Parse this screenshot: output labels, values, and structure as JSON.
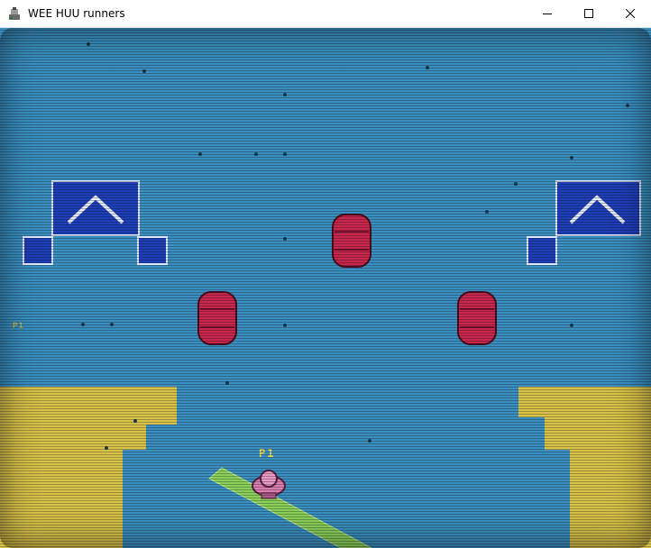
{
  "window": {
    "title": "WEE HUU runners",
    "icon": "game-app-icon",
    "controls": [
      "minimize-icon",
      "maximize-icon",
      "close-icon"
    ]
  },
  "hud": {
    "player_label": "P1",
    "side_label": "P1"
  },
  "colors": {
    "field": "#3a8fc0",
    "scanline_dark": "#1e5f86",
    "sand": "#d8c24a",
    "pad_blue": "#1f3fb8",
    "bumper_red": "#c8284e",
    "player_pink": "#d97fb0",
    "track_green": "#8ad05a"
  },
  "scene": {
    "bumpers": 3,
    "jump_pads": 2,
    "player": "pink-runner"
  }
}
